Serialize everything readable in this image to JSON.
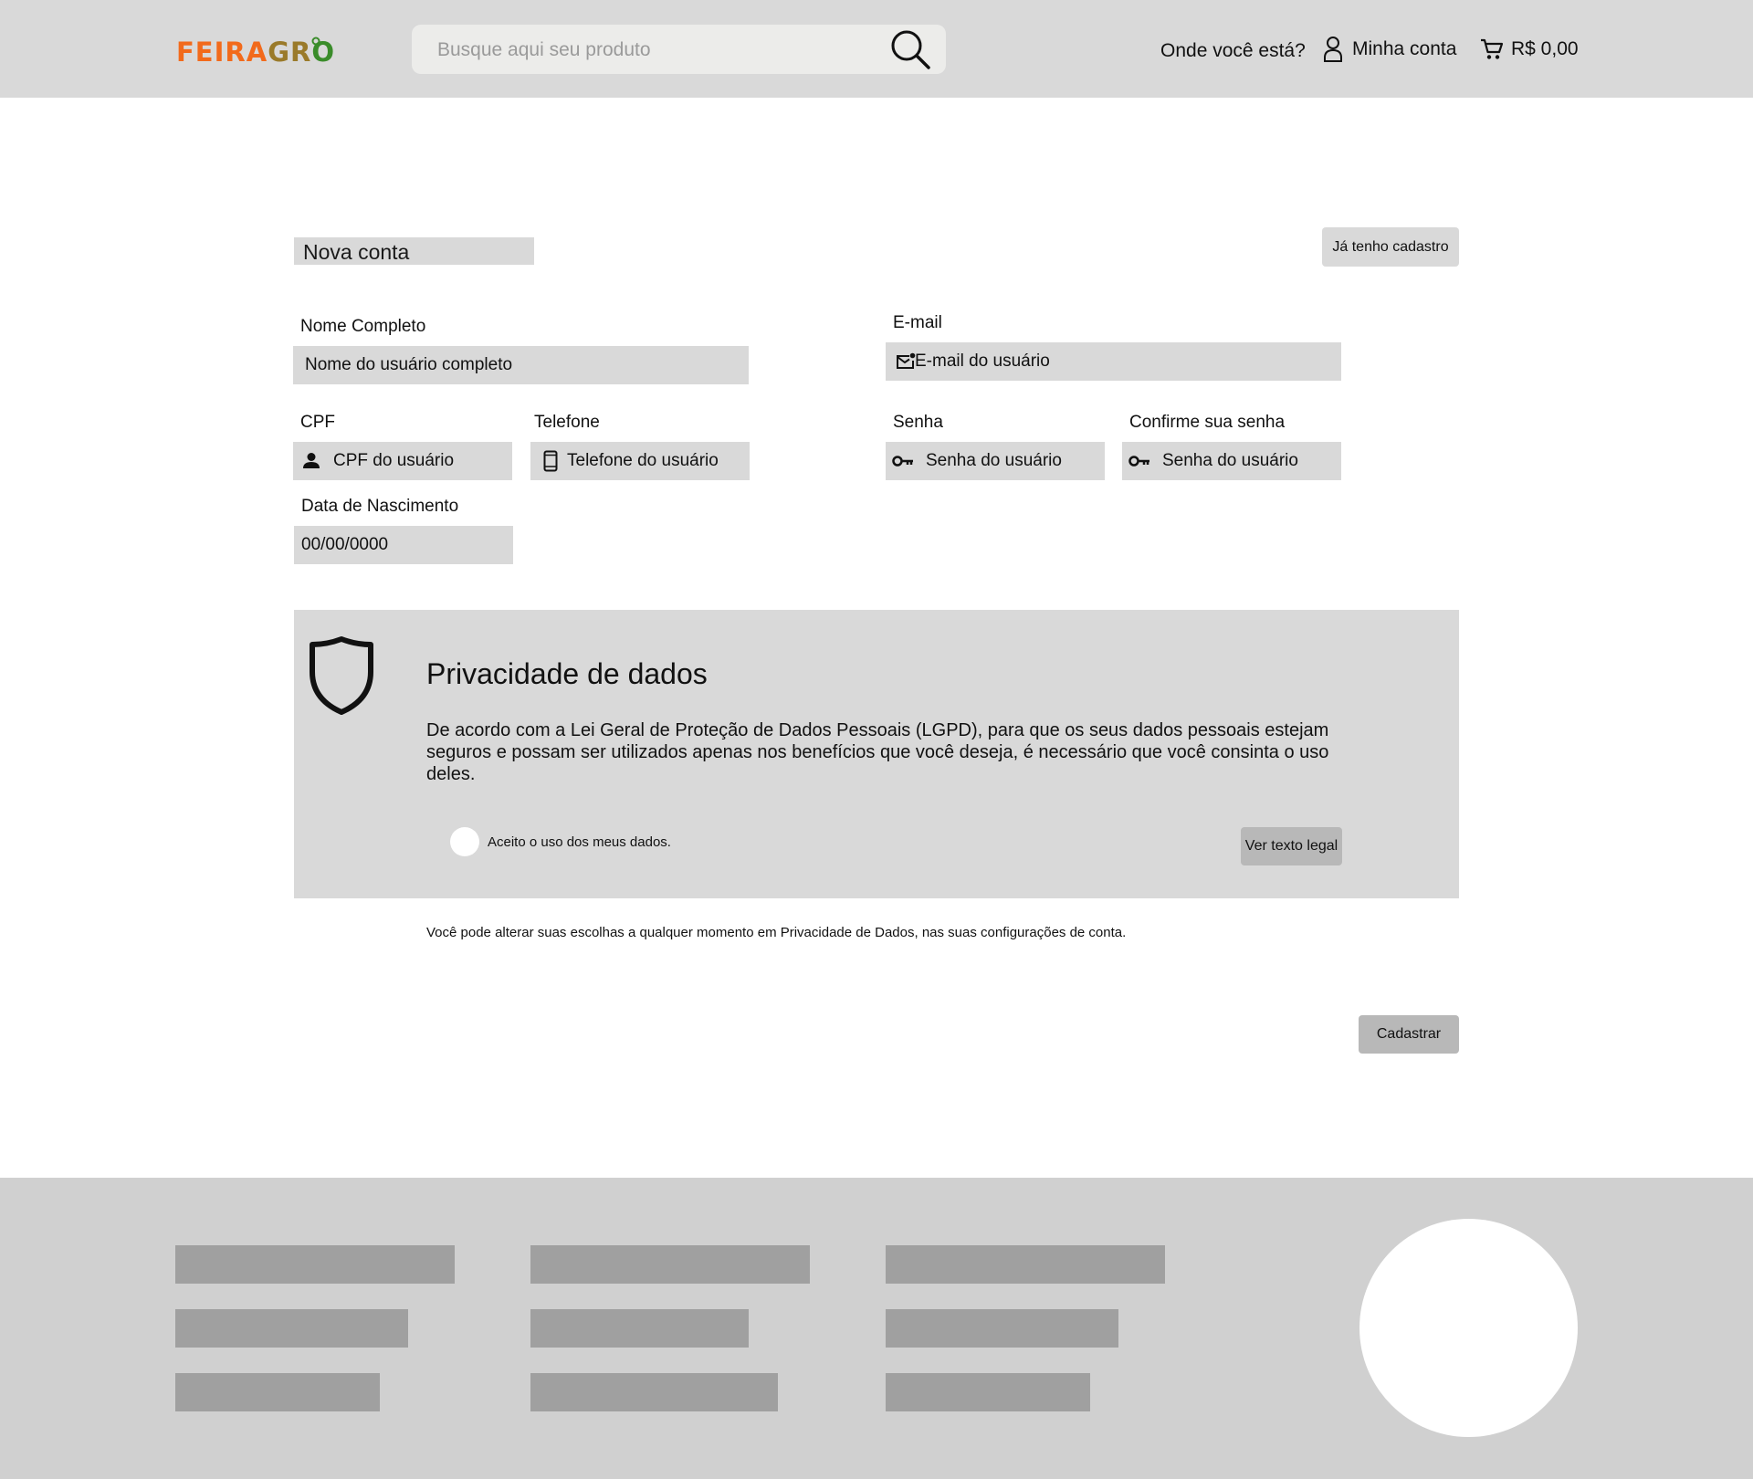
{
  "header": {
    "logo": {
      "part1": "FEIRA",
      "part2": "GR",
      "part3": "O"
    },
    "search": {
      "placeholder": "Busque aqui seu produto"
    },
    "location_label": "Onde você está?",
    "account_label": "Minha conta",
    "cart_total": "R$ 0,00"
  },
  "form": {
    "title": "Nova conta",
    "login_button": "Já tenho cadastro",
    "full_name": {
      "label": "Nome Completo",
      "placeholder": "Nome do usuário completo"
    },
    "email": {
      "label": "E-mail",
      "placeholder": "E-mail do usuário"
    },
    "cpf": {
      "label": "CPF",
      "placeholder": "CPF do usuário"
    },
    "phone": {
      "label": "Telefone",
      "placeholder": "Telefone do usuário"
    },
    "password": {
      "label": "Senha",
      "placeholder": "Senha do usuário"
    },
    "confirm_password": {
      "label": "Confirme sua senha",
      "placeholder": "Senha do usuário"
    },
    "birth_date": {
      "label": "Data de Nascimento",
      "placeholder": "00/00/0000"
    }
  },
  "privacy": {
    "title": "Privacidade de dados",
    "text": "De acordo com a Lei Geral de Proteção de Dados Pessoais (LGPD), para que os seus dados pessoais estejam seguros e possam ser utilizados apenas nos benefícios que você deseja, é necessário que você consinta o uso deles.",
    "consent_label": "Aceito o uso dos meus dados.",
    "legal_button": "Ver texto legal"
  },
  "note": "Você pode alterar suas escolhas a qualquer momento em Privacidade de Dados, nas suas configurações de conta.",
  "submit_button": "Cadastrar",
  "colors": {
    "header_bg": "#d9d9d9",
    "footer_bg": "#d0d0d0",
    "logo_orange": "#f26a1b",
    "logo_green": "#3a8c2a",
    "placeholder_bar": "#a0a0a0"
  },
  "icons": [
    "search-icon",
    "user-icon",
    "cart-icon",
    "mail-icon",
    "person-icon",
    "phone-icon",
    "key-icon",
    "shield-icon"
  ]
}
